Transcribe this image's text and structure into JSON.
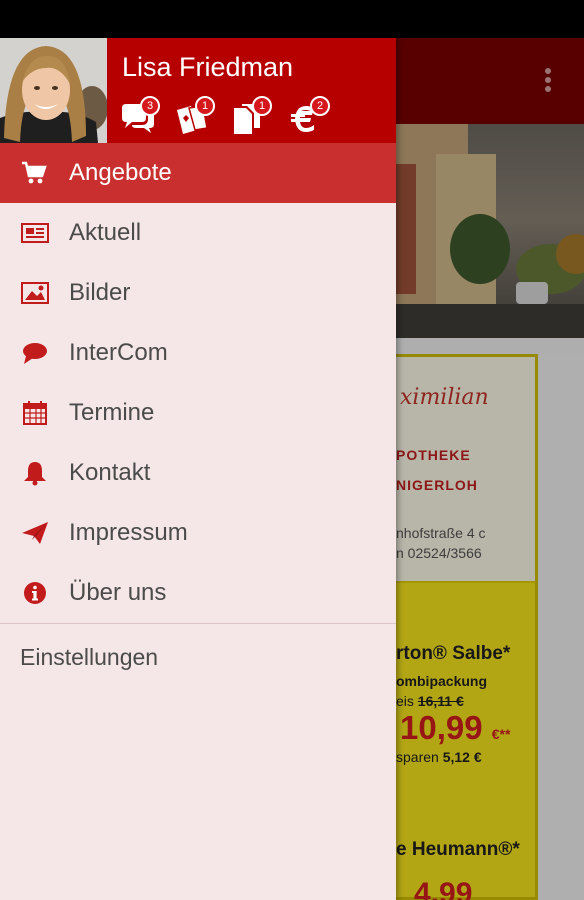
{
  "drawer": {
    "user_name": "Lisa Friedman",
    "badges": [
      {
        "icon": "chat-bubbles-icon",
        "count": "3"
      },
      {
        "icon": "cards-icon",
        "count": "1"
      },
      {
        "icon": "documents-icon",
        "count": "1"
      },
      {
        "icon": "euro-icon",
        "count": "2"
      }
    ],
    "menu": [
      {
        "label": "Angebote",
        "icon": "cart-icon",
        "active": true
      },
      {
        "label": "Aktuell",
        "icon": "newspaper-icon",
        "active": false
      },
      {
        "label": "Bilder",
        "icon": "picture-icon",
        "active": false
      },
      {
        "label": "InterCom",
        "icon": "chat-icon",
        "active": false
      },
      {
        "label": "Termine",
        "icon": "calendar-icon",
        "active": false
      },
      {
        "label": "Kontakt",
        "icon": "bell-icon",
        "active": false
      },
      {
        "label": "Impressum",
        "icon": "paper-plane-icon",
        "active": false
      },
      {
        "label": "Über uns",
        "icon": "info-icon",
        "active": false
      }
    ],
    "settings_label": "Einstellungen"
  },
  "background": {
    "flyer": {
      "logo": "ximilian",
      "line1": "POTHEKE",
      "line2": "NIGERLOH",
      "address1": "nhofstraße 4 c",
      "address2": "n 02524/3566",
      "product1": "rton® Salbe*",
      "product1_sub": "ombipackung",
      "old_price_label": "eis",
      "old_price": "16,11 €",
      "price": "10,99",
      "price_suffix": "€**",
      "save_label": "sparen",
      "save_amount": "5,12 €",
      "product2": "e Heumann®*",
      "price2": "4,99"
    }
  },
  "colors": {
    "primary": "#b60000",
    "active_item": "#c92f2f",
    "drawer_bg": "#f5e7e8",
    "icon": "#c21b1b",
    "text": "#4b4b4b"
  }
}
